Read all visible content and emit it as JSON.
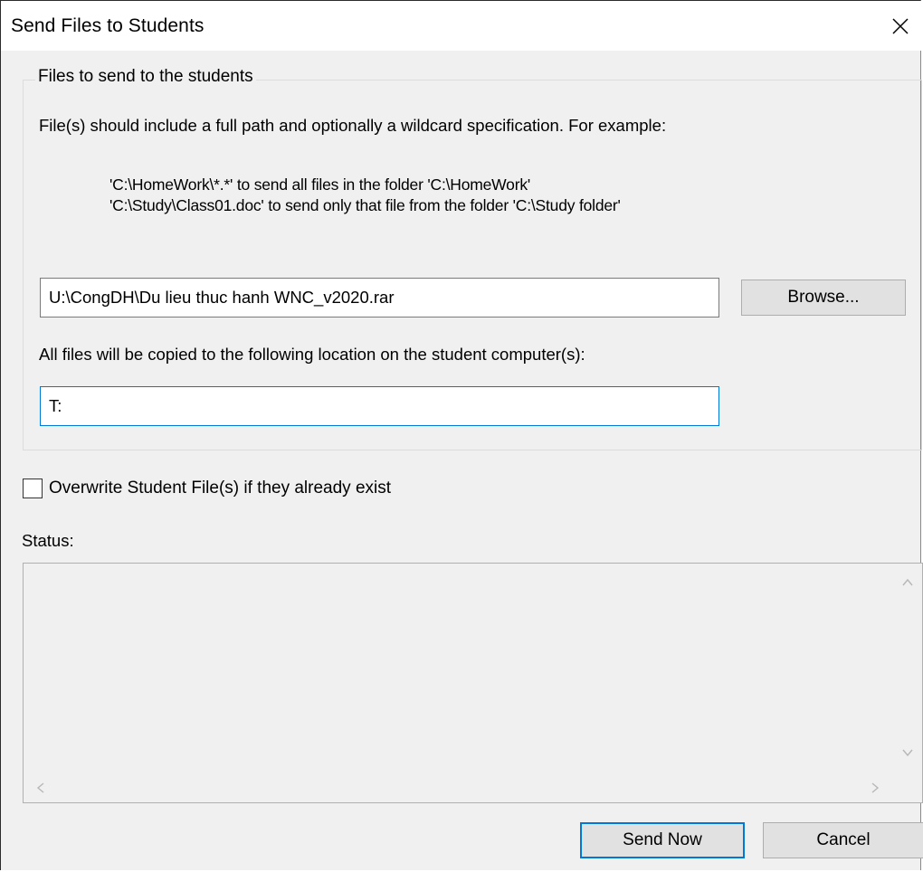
{
  "window": {
    "title": "Send Files to Students",
    "close_icon": "close-icon"
  },
  "files_group": {
    "legend": "Files to send to the students",
    "description": "File(s) should include a full path and optionally a wildcard specification. For example:",
    "examples": [
      "'C:\\HomeWork\\*.*' to send all files in the folder 'C:\\HomeWork'",
      "'C:\\Study\\Class01.doc' to send only that file from the folder 'C:\\Study folder'"
    ],
    "path_value": "U:\\CongDH\\Du lieu thuc hanh WNC_v2020.rar",
    "browse_label": "Browse...",
    "copy_label": "All files will be copied to the following location on the student computer(s):",
    "destination_value": "T:"
  },
  "overwrite": {
    "label": "Overwrite Student File(s) if they already exist",
    "checked": false
  },
  "status": {
    "label": "Status:",
    "text": ""
  },
  "buttons": {
    "send_now": "Send Now",
    "cancel": "Cancel"
  },
  "colors": {
    "accent": "#0078d7",
    "dialog_bg": "#f0f0f0",
    "button_bg": "#e1e1e1"
  }
}
